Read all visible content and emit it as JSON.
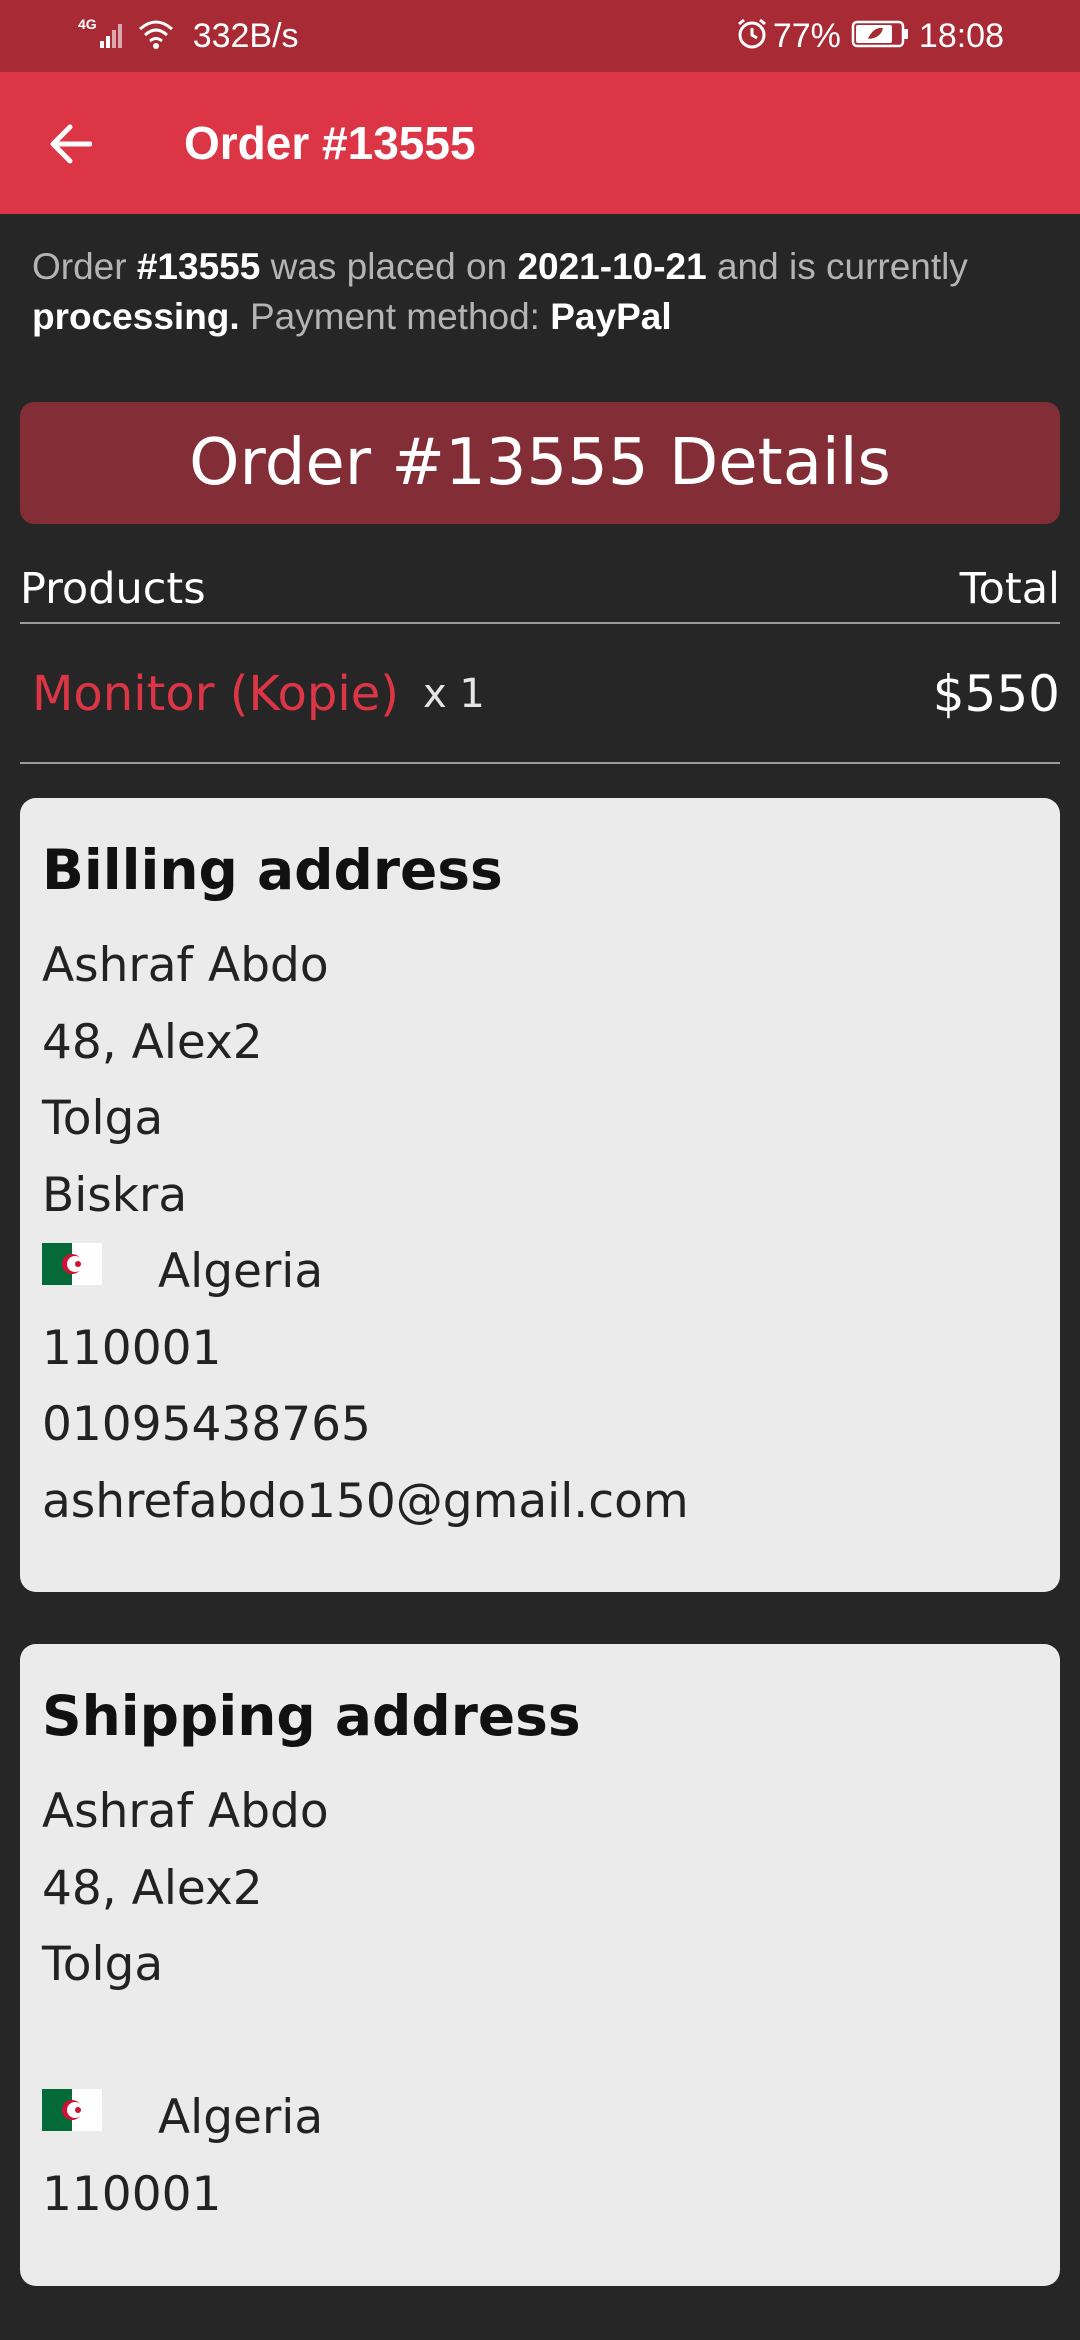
{
  "status_bar": {
    "network_type": "4G",
    "speed": "332B/s",
    "battery": "77%",
    "time": "18:08"
  },
  "app_bar": {
    "title": "Order #13555"
  },
  "summary": {
    "t1": "Order ",
    "order_number": "#13555",
    "t2": " was placed on ",
    "date": "2021-10-21",
    "t3": " and is currently ",
    "status": "processing.",
    "t4": " Payment method: ",
    "payment_method": "PayPal"
  },
  "details": {
    "header": "Order #13555 Details",
    "col_products": "Products",
    "col_total": "Total",
    "items": [
      {
        "name": "Monitor (Kopie)",
        "qty": "x 1",
        "total": "$550"
      }
    ]
  },
  "billing": {
    "title": "Billing address",
    "name": "Ashraf Abdo",
    "address": "48, Alex2",
    "city": "Tolga",
    "state": "Biskra",
    "country": "Algeria",
    "postcode": "110001",
    "phone": "01095438765",
    "email": "ashrefabdo150@gmail.com"
  },
  "shipping": {
    "title": "Shipping address",
    "name": "Ashraf Abdo",
    "address": "48, Alex2",
    "city": "Tolga",
    "state": "",
    "country": "Algeria",
    "postcode": "110001"
  },
  "colors": {
    "status_bar": "#a72a35",
    "app_bar": "#dc3545",
    "details_header": "#832d36",
    "background": "#262627",
    "card": "#ebebeb",
    "accent": "#dc3545"
  },
  "icons": {
    "back": "arrow-left-icon",
    "signal": "signal-icon",
    "wifi": "wifi-icon",
    "alarm": "alarm-icon",
    "battery": "battery-icon",
    "flag": "algeria-flag-icon"
  }
}
